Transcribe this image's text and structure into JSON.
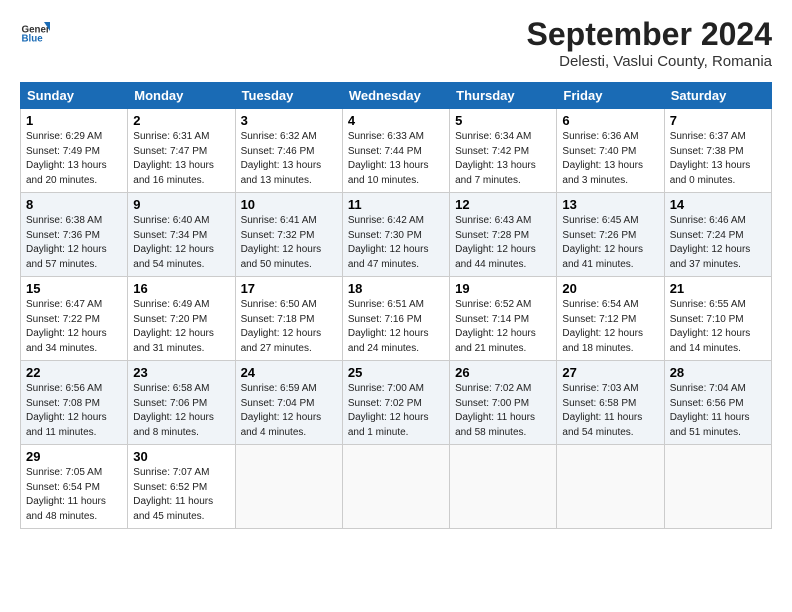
{
  "header": {
    "logo_general": "General",
    "logo_blue": "Blue",
    "month_title": "September 2024",
    "subtitle": "Delesti, Vaslui County, Romania"
  },
  "days_of_week": [
    "Sunday",
    "Monday",
    "Tuesday",
    "Wednesday",
    "Thursday",
    "Friday",
    "Saturday"
  ],
  "weeks": [
    [
      {
        "day": "1",
        "sunrise": "Sunrise: 6:29 AM",
        "sunset": "Sunset: 7:49 PM",
        "daylight": "Daylight: 13 hours and 20 minutes."
      },
      {
        "day": "2",
        "sunrise": "Sunrise: 6:31 AM",
        "sunset": "Sunset: 7:47 PM",
        "daylight": "Daylight: 13 hours and 16 minutes."
      },
      {
        "day": "3",
        "sunrise": "Sunrise: 6:32 AM",
        "sunset": "Sunset: 7:46 PM",
        "daylight": "Daylight: 13 hours and 13 minutes."
      },
      {
        "day": "4",
        "sunrise": "Sunrise: 6:33 AM",
        "sunset": "Sunset: 7:44 PM",
        "daylight": "Daylight: 13 hours and 10 minutes."
      },
      {
        "day": "5",
        "sunrise": "Sunrise: 6:34 AM",
        "sunset": "Sunset: 7:42 PM",
        "daylight": "Daylight: 13 hours and 7 minutes."
      },
      {
        "day": "6",
        "sunrise": "Sunrise: 6:36 AM",
        "sunset": "Sunset: 7:40 PM",
        "daylight": "Daylight: 13 hours and 3 minutes."
      },
      {
        "day": "7",
        "sunrise": "Sunrise: 6:37 AM",
        "sunset": "Sunset: 7:38 PM",
        "daylight": "Daylight: 13 hours and 0 minutes."
      }
    ],
    [
      {
        "day": "8",
        "sunrise": "Sunrise: 6:38 AM",
        "sunset": "Sunset: 7:36 PM",
        "daylight": "Daylight: 12 hours and 57 minutes."
      },
      {
        "day": "9",
        "sunrise": "Sunrise: 6:40 AM",
        "sunset": "Sunset: 7:34 PM",
        "daylight": "Daylight: 12 hours and 54 minutes."
      },
      {
        "day": "10",
        "sunrise": "Sunrise: 6:41 AM",
        "sunset": "Sunset: 7:32 PM",
        "daylight": "Daylight: 12 hours and 50 minutes."
      },
      {
        "day": "11",
        "sunrise": "Sunrise: 6:42 AM",
        "sunset": "Sunset: 7:30 PM",
        "daylight": "Daylight: 12 hours and 47 minutes."
      },
      {
        "day": "12",
        "sunrise": "Sunrise: 6:43 AM",
        "sunset": "Sunset: 7:28 PM",
        "daylight": "Daylight: 12 hours and 44 minutes."
      },
      {
        "day": "13",
        "sunrise": "Sunrise: 6:45 AM",
        "sunset": "Sunset: 7:26 PM",
        "daylight": "Daylight: 12 hours and 41 minutes."
      },
      {
        "day": "14",
        "sunrise": "Sunrise: 6:46 AM",
        "sunset": "Sunset: 7:24 PM",
        "daylight": "Daylight: 12 hours and 37 minutes."
      }
    ],
    [
      {
        "day": "15",
        "sunrise": "Sunrise: 6:47 AM",
        "sunset": "Sunset: 7:22 PM",
        "daylight": "Daylight: 12 hours and 34 minutes."
      },
      {
        "day": "16",
        "sunrise": "Sunrise: 6:49 AM",
        "sunset": "Sunset: 7:20 PM",
        "daylight": "Daylight: 12 hours and 31 minutes."
      },
      {
        "day": "17",
        "sunrise": "Sunrise: 6:50 AM",
        "sunset": "Sunset: 7:18 PM",
        "daylight": "Daylight: 12 hours and 27 minutes."
      },
      {
        "day": "18",
        "sunrise": "Sunrise: 6:51 AM",
        "sunset": "Sunset: 7:16 PM",
        "daylight": "Daylight: 12 hours and 24 minutes."
      },
      {
        "day": "19",
        "sunrise": "Sunrise: 6:52 AM",
        "sunset": "Sunset: 7:14 PM",
        "daylight": "Daylight: 12 hours and 21 minutes."
      },
      {
        "day": "20",
        "sunrise": "Sunrise: 6:54 AM",
        "sunset": "Sunset: 7:12 PM",
        "daylight": "Daylight: 12 hours and 18 minutes."
      },
      {
        "day": "21",
        "sunrise": "Sunrise: 6:55 AM",
        "sunset": "Sunset: 7:10 PM",
        "daylight": "Daylight: 12 hours and 14 minutes."
      }
    ],
    [
      {
        "day": "22",
        "sunrise": "Sunrise: 6:56 AM",
        "sunset": "Sunset: 7:08 PM",
        "daylight": "Daylight: 12 hours and 11 minutes."
      },
      {
        "day": "23",
        "sunrise": "Sunrise: 6:58 AM",
        "sunset": "Sunset: 7:06 PM",
        "daylight": "Daylight: 12 hours and 8 minutes."
      },
      {
        "day": "24",
        "sunrise": "Sunrise: 6:59 AM",
        "sunset": "Sunset: 7:04 PM",
        "daylight": "Daylight: 12 hours and 4 minutes."
      },
      {
        "day": "25",
        "sunrise": "Sunrise: 7:00 AM",
        "sunset": "Sunset: 7:02 PM",
        "daylight": "Daylight: 12 hours and 1 minute."
      },
      {
        "day": "26",
        "sunrise": "Sunrise: 7:02 AM",
        "sunset": "Sunset: 7:00 PM",
        "daylight": "Daylight: 11 hours and 58 minutes."
      },
      {
        "day": "27",
        "sunrise": "Sunrise: 7:03 AM",
        "sunset": "Sunset: 6:58 PM",
        "daylight": "Daylight: 11 hours and 54 minutes."
      },
      {
        "day": "28",
        "sunrise": "Sunrise: 7:04 AM",
        "sunset": "Sunset: 6:56 PM",
        "daylight": "Daylight: 11 hours and 51 minutes."
      }
    ],
    [
      {
        "day": "29",
        "sunrise": "Sunrise: 7:05 AM",
        "sunset": "Sunset: 6:54 PM",
        "daylight": "Daylight: 11 hours and 48 minutes."
      },
      {
        "day": "30",
        "sunrise": "Sunrise: 7:07 AM",
        "sunset": "Sunset: 6:52 PM",
        "daylight": "Daylight: 11 hours and 45 minutes."
      },
      null,
      null,
      null,
      null,
      null
    ]
  ]
}
